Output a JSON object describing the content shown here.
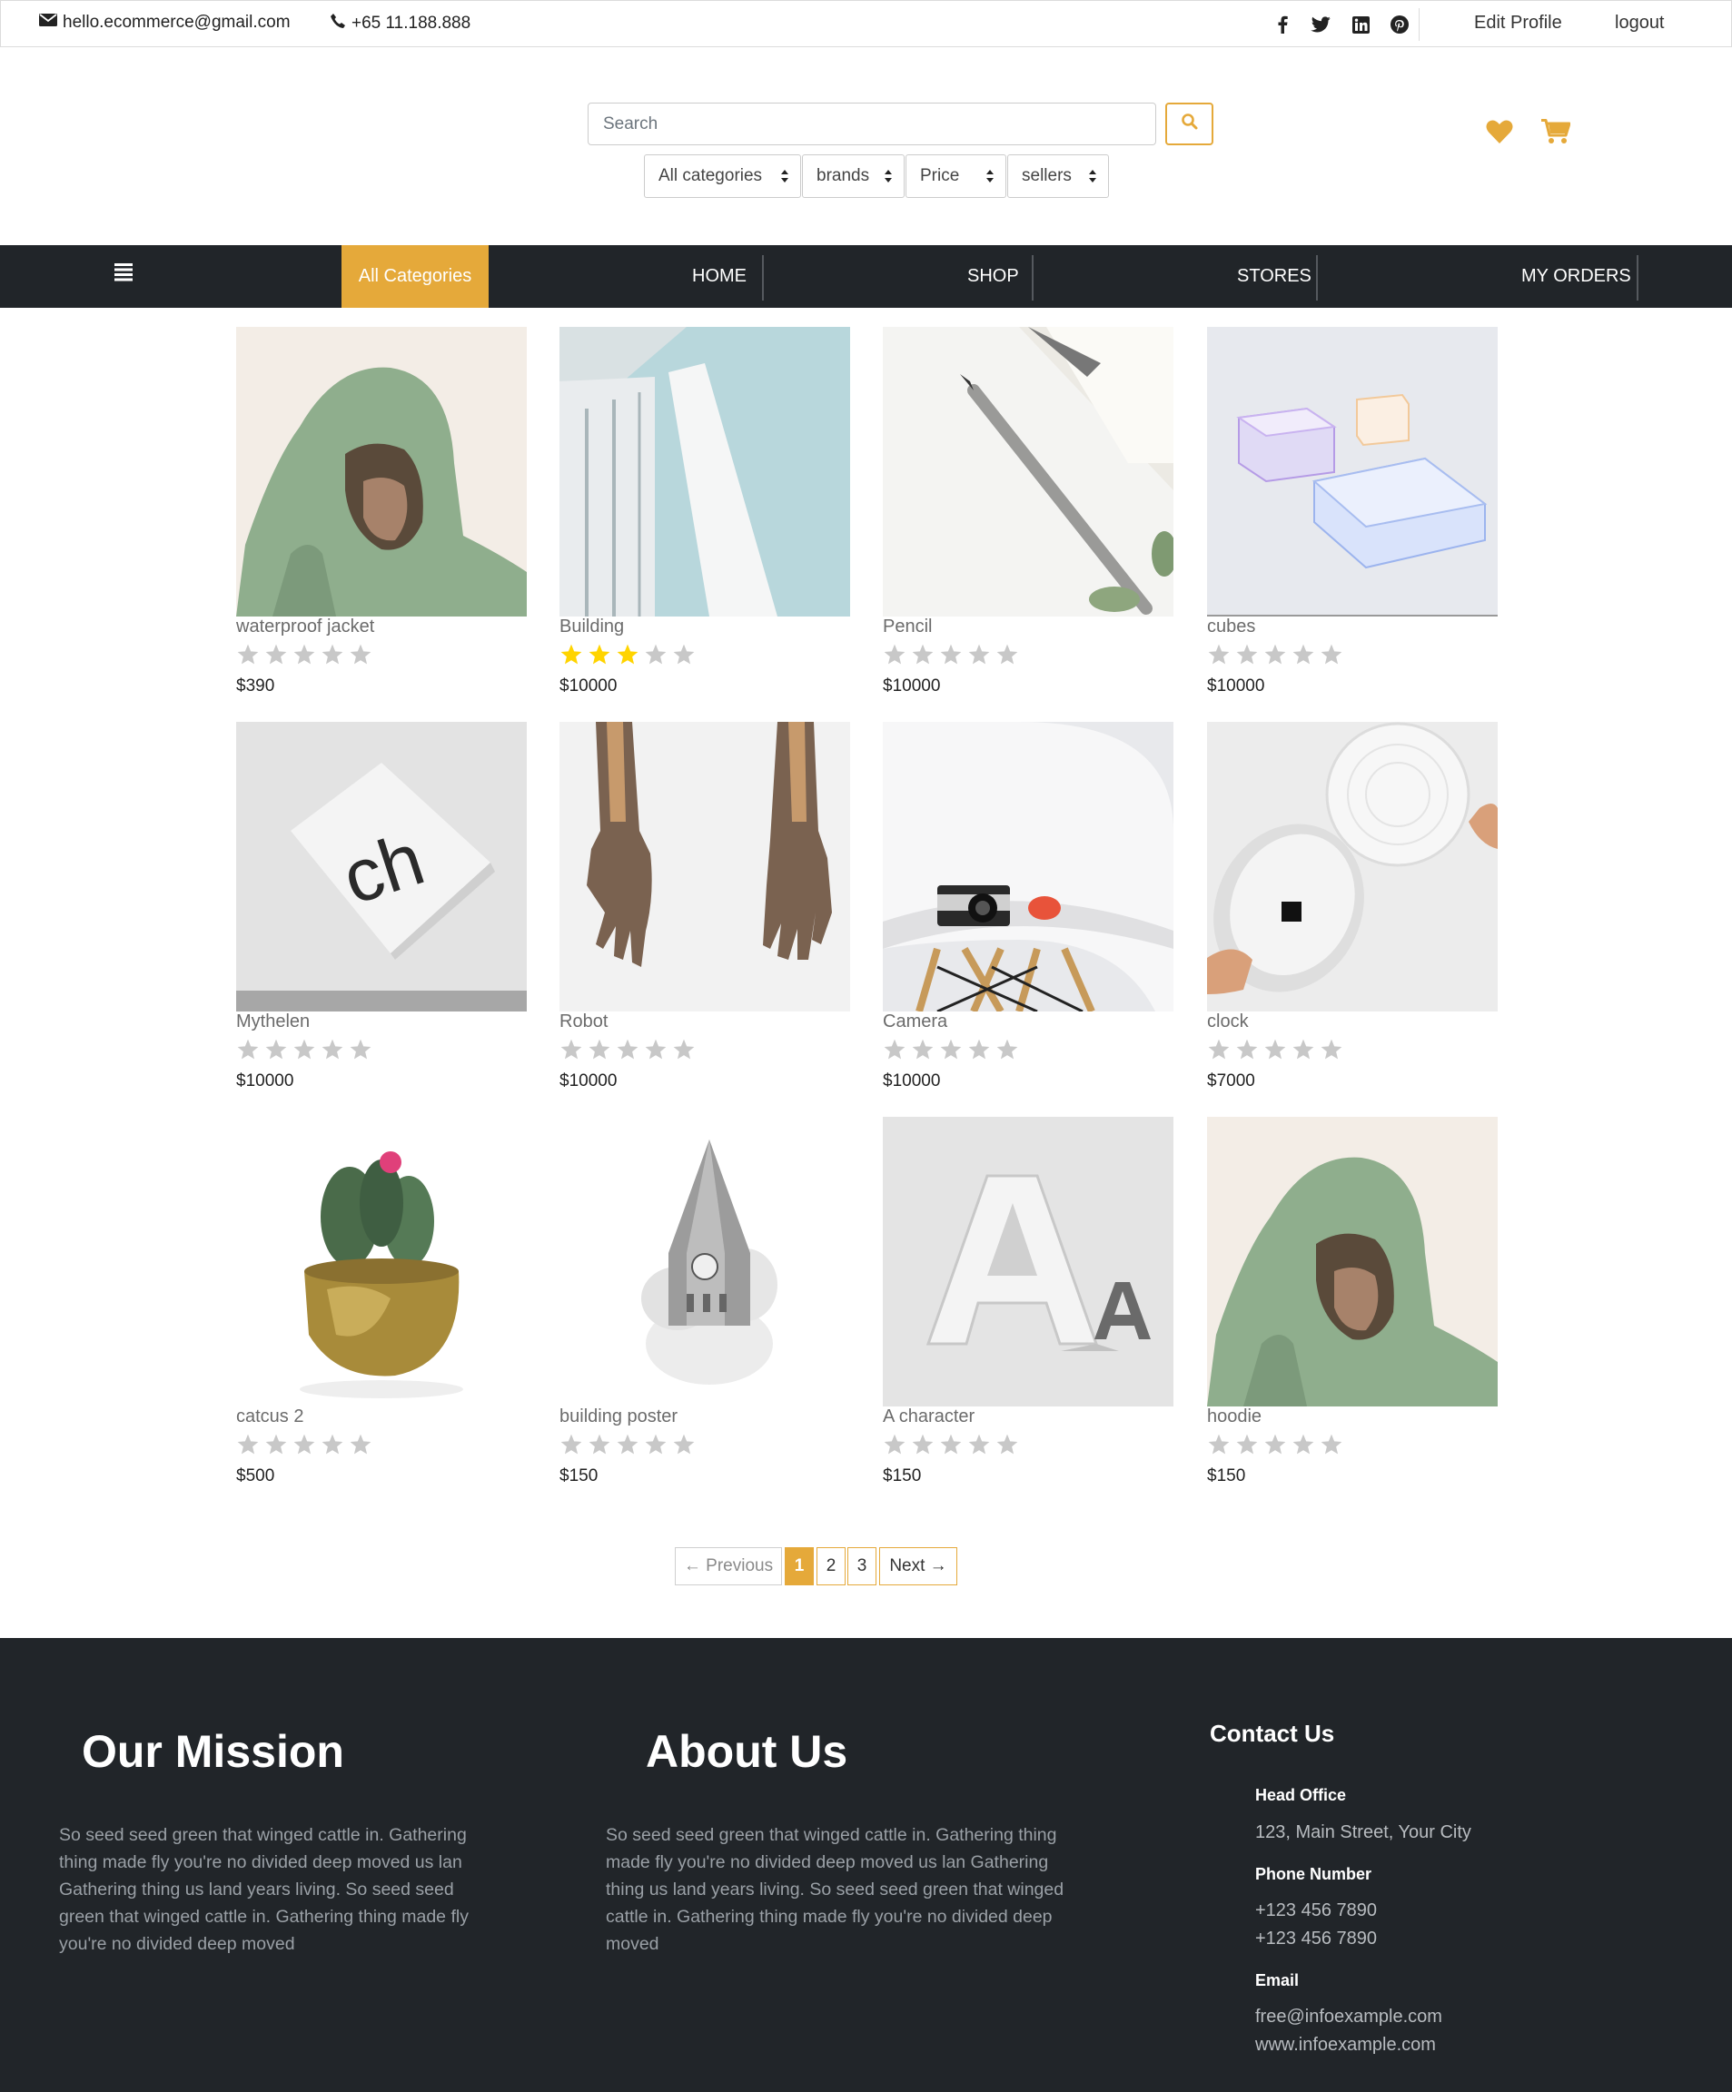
{
  "topbar": {
    "email": "hello.ecommerce@gmail.com",
    "phone": "+65 11.188.888",
    "social_icons": [
      "facebook-icon",
      "twitter-icon",
      "linkedin-icon",
      "pinterest-icon"
    ],
    "edit_profile": "Edit Profile",
    "logout": "logout"
  },
  "search": {
    "placeholder": "Search",
    "filters": [
      "All categories",
      "brands",
      "Price",
      "sellers"
    ]
  },
  "navbar": {
    "all_categories": "All Categories",
    "items": [
      "HOME",
      "SHOP",
      "STORES",
      "MY ORDERS"
    ]
  },
  "colors": {
    "accent": "#e5a93a",
    "dark": "#212529",
    "star_filled": "#ffd400",
    "star_empty": "#c8c8c8"
  },
  "products": [
    {
      "name": "waterproof jacket",
      "price": "$390",
      "rating": 0
    },
    {
      "name": "Building",
      "price": "$10000",
      "rating": 3
    },
    {
      "name": "Pencil",
      "price": "$10000",
      "rating": 0
    },
    {
      "name": "cubes",
      "price": "$10000",
      "rating": 0
    },
    {
      "name": "Mythelen",
      "price": "$10000",
      "rating": 0
    },
    {
      "name": "Robot",
      "price": "$10000",
      "rating": 0
    },
    {
      "name": "Camera",
      "price": "$10000",
      "rating": 0
    },
    {
      "name": "clock",
      "price": "$7000",
      "rating": 0
    },
    {
      "name": "catcus 2",
      "price": "$500",
      "rating": 0
    },
    {
      "name": "building poster",
      "price": "$150",
      "rating": 0
    },
    {
      "name": "A character",
      "price": "$150",
      "rating": 0
    },
    {
      "name": "hoodie",
      "price": "$150",
      "rating": 0
    }
  ],
  "pagination": {
    "previous": "← Previous",
    "pages": [
      "1",
      "2",
      "3"
    ],
    "current": "1",
    "next": "Next →"
  },
  "footer": {
    "mission_title": "Our Mission",
    "mission_lines": [
      "So seed seed green that winged cattle in. Gathering",
      "thing made fly you're no divided deep moved us lan",
      "Gathering thing us land years living. So seed seed",
      "green that winged cattle in. Gathering thing made fly",
      "you're no divided deep moved"
    ],
    "about_title": "About Us",
    "about_lines": [
      "So seed seed green that winged cattle in. Gathering thing",
      "made fly you're no divided deep moved us lan Gathering",
      "thing us land years living. So seed seed green that winged",
      "cattle in. Gathering thing made fly you're no divided deep",
      "moved"
    ],
    "contact_title": "Contact Us",
    "head_office_label": "Head Office",
    "address": "123, Main Street, Your City",
    "phone_label": "Phone Number",
    "phones": [
      "+123 456 7890",
      "+123 456 7890"
    ],
    "email_label": "Email",
    "email": "free@infoexample.com",
    "website": "www.infoexample.com"
  }
}
